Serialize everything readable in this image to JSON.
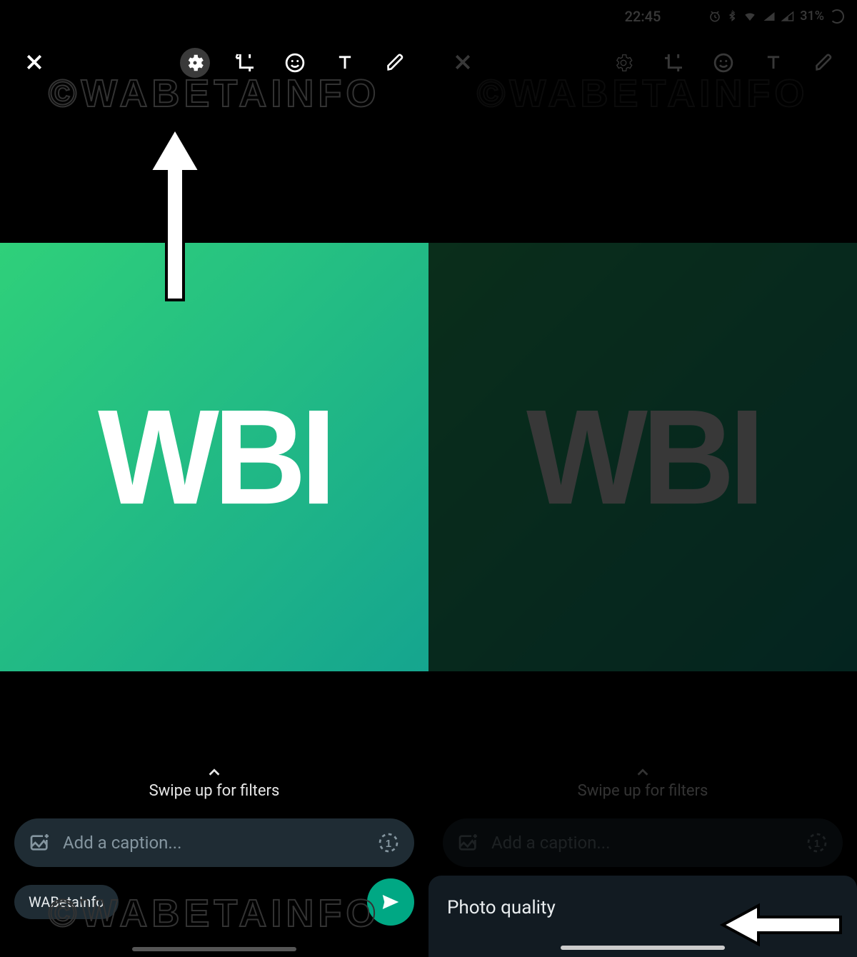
{
  "statusbar": {
    "time": "22:45",
    "battery_percent": "31%"
  },
  "watermark": "©WABETAINFO",
  "toolbar": {
    "close_icon": "close-icon",
    "tools": [
      "gear-icon",
      "crop-rotate-icon",
      "emoji-icon",
      "text-icon",
      "pencil-icon"
    ]
  },
  "image": {
    "logo_text": "WBI"
  },
  "filters_hint": "Swipe up for filters",
  "caption": {
    "placeholder": "Add a caption...",
    "gallery_icon": "gallery-add-icon",
    "view_once_icon": "view-once-icon"
  },
  "recipient_chip": "WABetaInfo",
  "send_icon": "send-icon",
  "sheet": {
    "title": "Photo quality"
  }
}
